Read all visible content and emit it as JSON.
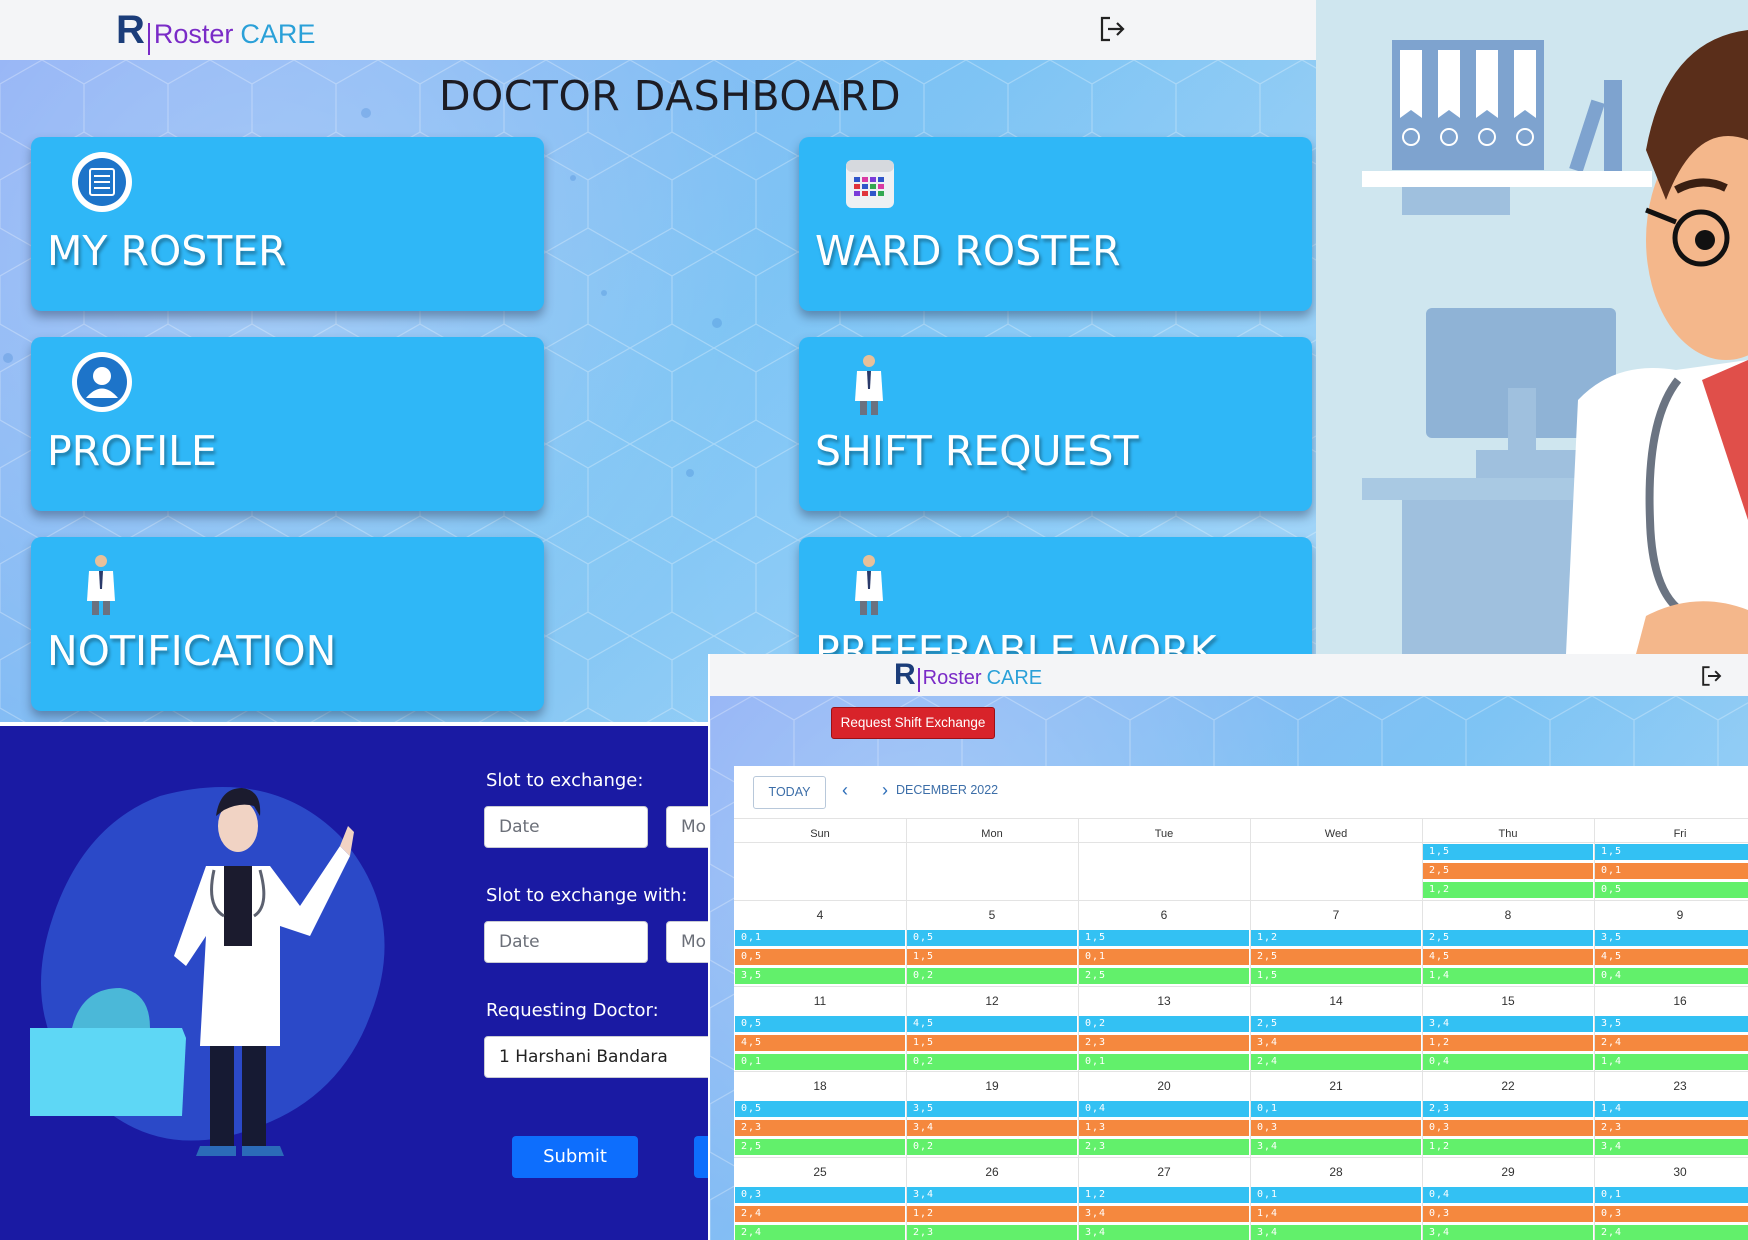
{
  "dashboard": {
    "logo": {
      "r": "R",
      "roster": "Roster",
      "care": "CARE"
    },
    "title": "DOCTOR DASHBOARD",
    "tiles": [
      {
        "label": "MY ROSTER",
        "icon": "roster-list-icon"
      },
      {
        "label": "WARD ROSTER",
        "icon": "calendar-icon"
      },
      {
        "label": "PROFILE",
        "icon": "user-icon"
      },
      {
        "label": "SHIFT REQUEST",
        "icon": "doctor-icon"
      },
      {
        "label": "NOTIFICATION",
        "icon": "doctor-icon"
      },
      {
        "label": "PREFERABLE WORK",
        "icon": "doctor-icon"
      }
    ],
    "logout_icon": "logout-icon"
  },
  "form": {
    "slot_label": "Slot to exchange:",
    "slot_with_label": "Slot to exchange with:",
    "date_placeholder": "Date",
    "session_placeholder": "Mo",
    "requesting_label": "Requesting Doctor:",
    "requesting_value": "1 Harshani Bandara",
    "submit_label": "Submit"
  },
  "calendar": {
    "logo": {
      "r": "R",
      "roster": "Roster",
      "care": "CARE"
    },
    "request_button": "Request Shift Exchange",
    "today_button": "TODAY",
    "month": "DECEMBER 2022",
    "days_of_week": [
      "Sun",
      "Mon",
      "Tue",
      "Wed",
      "Thu",
      "Fri"
    ],
    "weeks": [
      {
        "days": [
          {
            "num": "",
            "events": []
          },
          {
            "num": "",
            "events": []
          },
          {
            "num": "",
            "events": []
          },
          {
            "num": "",
            "events": []
          },
          {
            "num": "",
            "events": [
              "1,5",
              "2,5",
              "1,2"
            ]
          },
          {
            "num": "",
            "events": [
              "1,5",
              "0,1",
              "0,5"
            ]
          }
        ]
      },
      {
        "days": [
          {
            "num": "4",
            "events": [
              "0,1",
              "0,5",
              "3,5"
            ]
          },
          {
            "num": "5",
            "events": [
              "0,5",
              "1,5",
              "0,2"
            ]
          },
          {
            "num": "6",
            "events": [
              "1,5",
              "0,1",
              "2,5"
            ]
          },
          {
            "num": "7",
            "events": [
              "1,2",
              "2,5",
              "1,5"
            ]
          },
          {
            "num": "8",
            "events": [
              "2,5",
              "4,5",
              "1,4"
            ]
          },
          {
            "num": "9",
            "events": [
              "3,5",
              "4,5",
              "0,4"
            ]
          }
        ]
      },
      {
        "days": [
          {
            "num": "11",
            "events": [
              "0,5",
              "4,5",
              "0,1"
            ]
          },
          {
            "num": "12",
            "events": [
              "4,5",
              "1,5",
              "0,2"
            ]
          },
          {
            "num": "13",
            "events": [
              "0,2",
              "2,3",
              "0,1"
            ]
          },
          {
            "num": "14",
            "events": [
              "2,5",
              "3,4",
              "2,4"
            ]
          },
          {
            "num": "15",
            "events": [
              "3,4",
              "1,2",
              "0,4"
            ]
          },
          {
            "num": "16",
            "events": [
              "3,5",
              "2,4",
              "1,4"
            ]
          }
        ]
      },
      {
        "days": [
          {
            "num": "18",
            "events": [
              "0,5",
              "2,3",
              "2,5"
            ]
          },
          {
            "num": "19",
            "events": [
              "3,5",
              "3,4",
              "0,2"
            ]
          },
          {
            "num": "20",
            "events": [
              "0,4",
              "1,3",
              "2,3"
            ]
          },
          {
            "num": "21",
            "events": [
              "0,1",
              "0,3",
              "3,4"
            ]
          },
          {
            "num": "22",
            "events": [
              "2,3",
              "0,3",
              "1,2"
            ]
          },
          {
            "num": "23",
            "events": [
              "1,4",
              "2,3",
              "3,4"
            ]
          }
        ]
      },
      {
        "days": [
          {
            "num": "25",
            "events": [
              "0,3",
              "2,4",
              "2,4"
            ]
          },
          {
            "num": "26",
            "events": [
              "3,4",
              "1,2",
              "2,3"
            ]
          },
          {
            "num": "27",
            "events": [
              "1,2",
              "3,4",
              "3,4"
            ]
          },
          {
            "num": "28",
            "events": [
              "0,1",
              "1,4",
              "3,4"
            ]
          },
          {
            "num": "29",
            "events": [
              "0,4",
              "0,3",
              "3,4"
            ]
          },
          {
            "num": "30",
            "events": [
              "0,1",
              "0,3",
              "2,4"
            ]
          }
        ]
      }
    ],
    "event_colors": {
      "row1": "#33c1f3",
      "row2": "#f5883e",
      "row3": "#62f06b"
    }
  }
}
